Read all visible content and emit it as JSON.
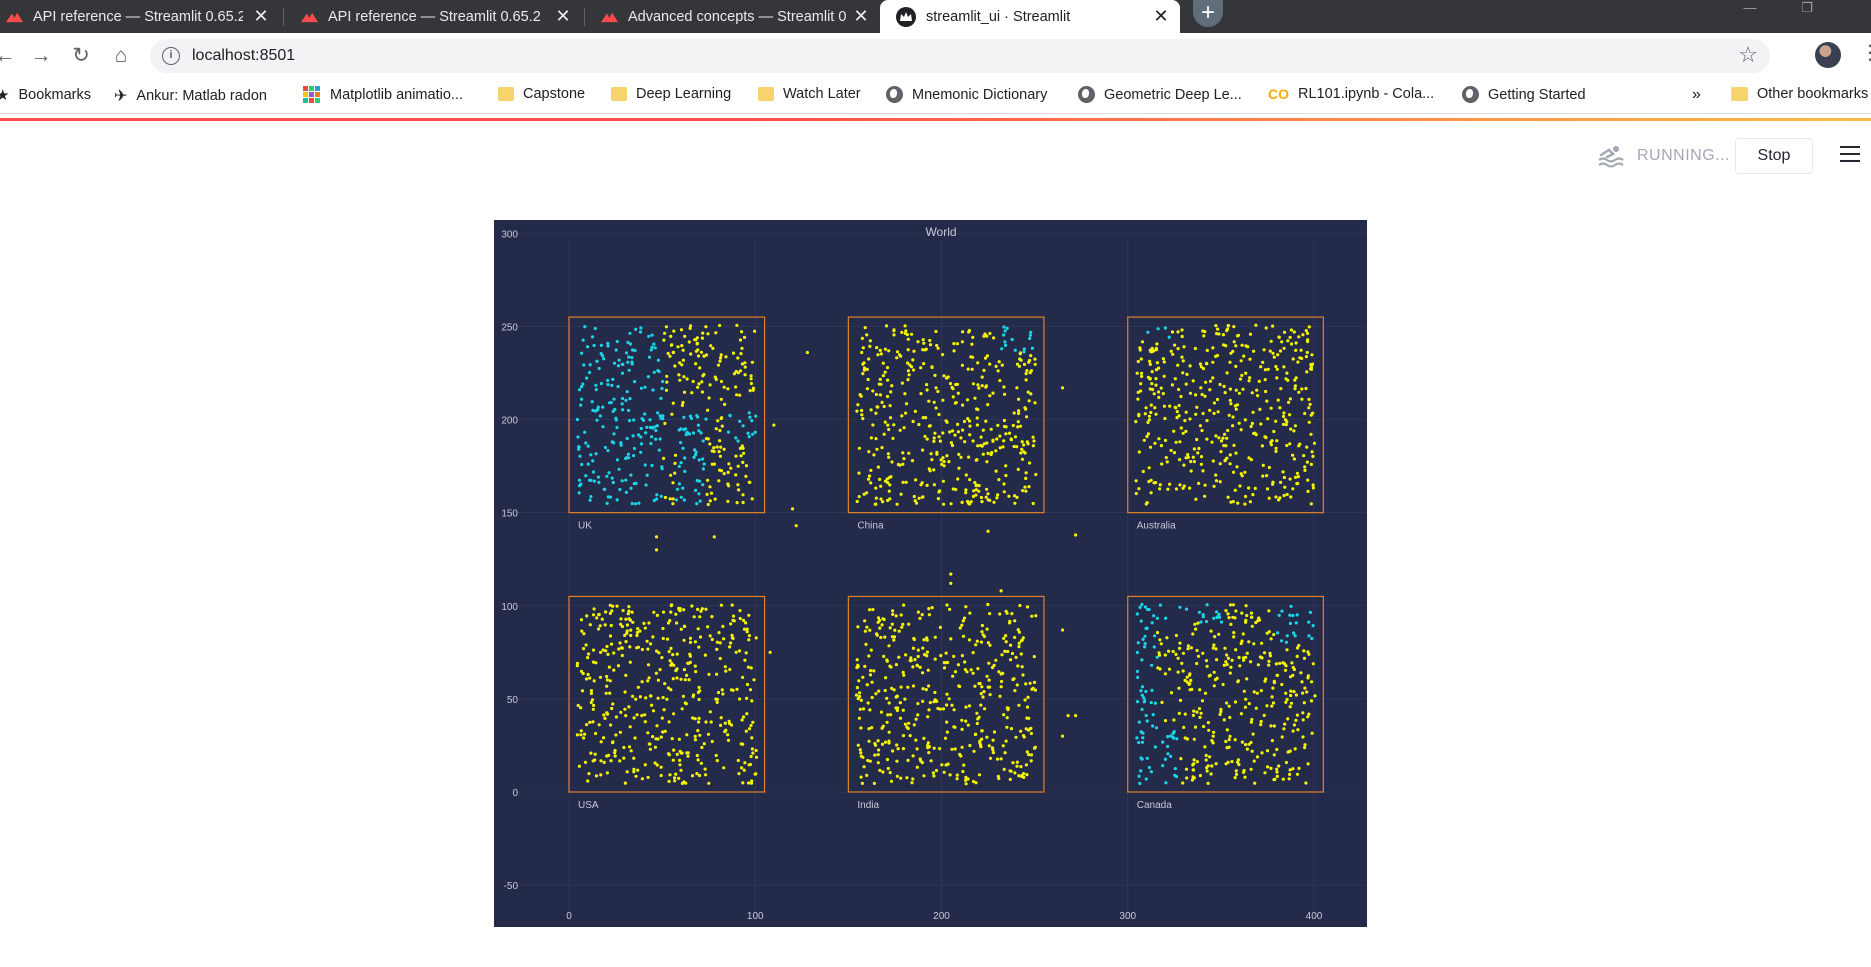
{
  "browser": {
    "tabs": [
      {
        "title": "API reference — Streamlit 0.65.2",
        "active": false,
        "favicon": "streamlit-icon"
      },
      {
        "title": "API reference — Streamlit 0.65.2",
        "active": false,
        "favicon": "streamlit-icon"
      },
      {
        "title": "Advanced concepts — Streamlit 0",
        "active": false,
        "favicon": "streamlit-icon"
      },
      {
        "title": "streamlit_ui · Streamlit",
        "active": true,
        "favicon": "streamlit-crown-icon"
      }
    ],
    "close_glyph": "✕",
    "new_tab_glyph": "+",
    "url": "localhost:8501",
    "bookmarks": [
      {
        "label": "Bookmarks",
        "icon": "star-icon"
      },
      {
        "label": "Ankur: Matlab radon",
        "icon": "bird-icon"
      },
      {
        "label": "Matplotlib animatio...",
        "icon": "grid-icon"
      },
      {
        "label": "Capstone",
        "icon": "folder-icon"
      },
      {
        "label": "Deep Learning",
        "icon": "folder-icon"
      },
      {
        "label": "Watch Later",
        "icon": "folder-icon"
      },
      {
        "label": "Mnemonic Dictionary",
        "icon": "globe-icon"
      },
      {
        "label": "Geometric Deep Le...",
        "icon": "globe-icon"
      },
      {
        "label": "RL101.ipynb - Cola...",
        "icon": "colab-icon"
      },
      {
        "label": "Getting Started",
        "icon": "globe-icon"
      }
    ],
    "overflow_glyph": "»",
    "other_bookmarks": "Other bookmarks"
  },
  "app": {
    "status": "RUNNING...",
    "stop_label": "Stop"
  },
  "colors": {
    "plot_bg": "#232a4a",
    "grid": "#323a5c",
    "box_border": "#e0812a",
    "point_yellow": "#f5f500",
    "point_cyan": "#1ad6e6",
    "text": "#c8cad8"
  },
  "chart_data": {
    "type": "scatter",
    "title": "World",
    "xlabel": "",
    "ylabel": "",
    "xlim": [
      -20,
      420
    ],
    "ylim": [
      -60,
      310
    ],
    "xticks": [
      0,
      100,
      200,
      300,
      400
    ],
    "yticks": [
      -50,
      0,
      50,
      100,
      150,
      200,
      250,
      300
    ],
    "grid": true,
    "regions": [
      {
        "name": "UK",
        "x": [
          0,
          105
        ],
        "y": [
          150,
          255
        ],
        "cyan_zone": "left-half"
      },
      {
        "name": "China",
        "x": [
          150,
          255
        ],
        "y": [
          150,
          255
        ],
        "cyan_zone": "top-right-corner"
      },
      {
        "name": "Australia",
        "x": [
          300,
          405
        ],
        "y": [
          150,
          255
        ],
        "cyan_zone": "top-left-corner"
      },
      {
        "name": "USA",
        "x": [
          0,
          105
        ],
        "y": [
          0,
          105
        ],
        "cyan_zone": "none"
      },
      {
        "name": "India",
        "x": [
          150,
          255
        ],
        "y": [
          0,
          105
        ],
        "cyan_zone": "none"
      },
      {
        "name": "Canada",
        "x": [
          300,
          405
        ],
        "y": [
          0,
          105
        ],
        "cyan_zone": "left-edge-and-top-right"
      }
    ],
    "outliers": [
      [
        128,
        236
      ],
      [
        110,
        197
      ],
      [
        120,
        152
      ],
      [
        122,
        143
      ],
      [
        47,
        137
      ],
      [
        47,
        130
      ],
      [
        78,
        137
      ],
      [
        265,
        217
      ],
      [
        272,
        138
      ],
      [
        225,
        140
      ],
      [
        205,
        117
      ],
      [
        205,
        112
      ],
      [
        232,
        108
      ],
      [
        108,
        75
      ],
      [
        265,
        87
      ],
      [
        268,
        41
      ],
      [
        272,
        41
      ],
      [
        265,
        30
      ]
    ]
  }
}
